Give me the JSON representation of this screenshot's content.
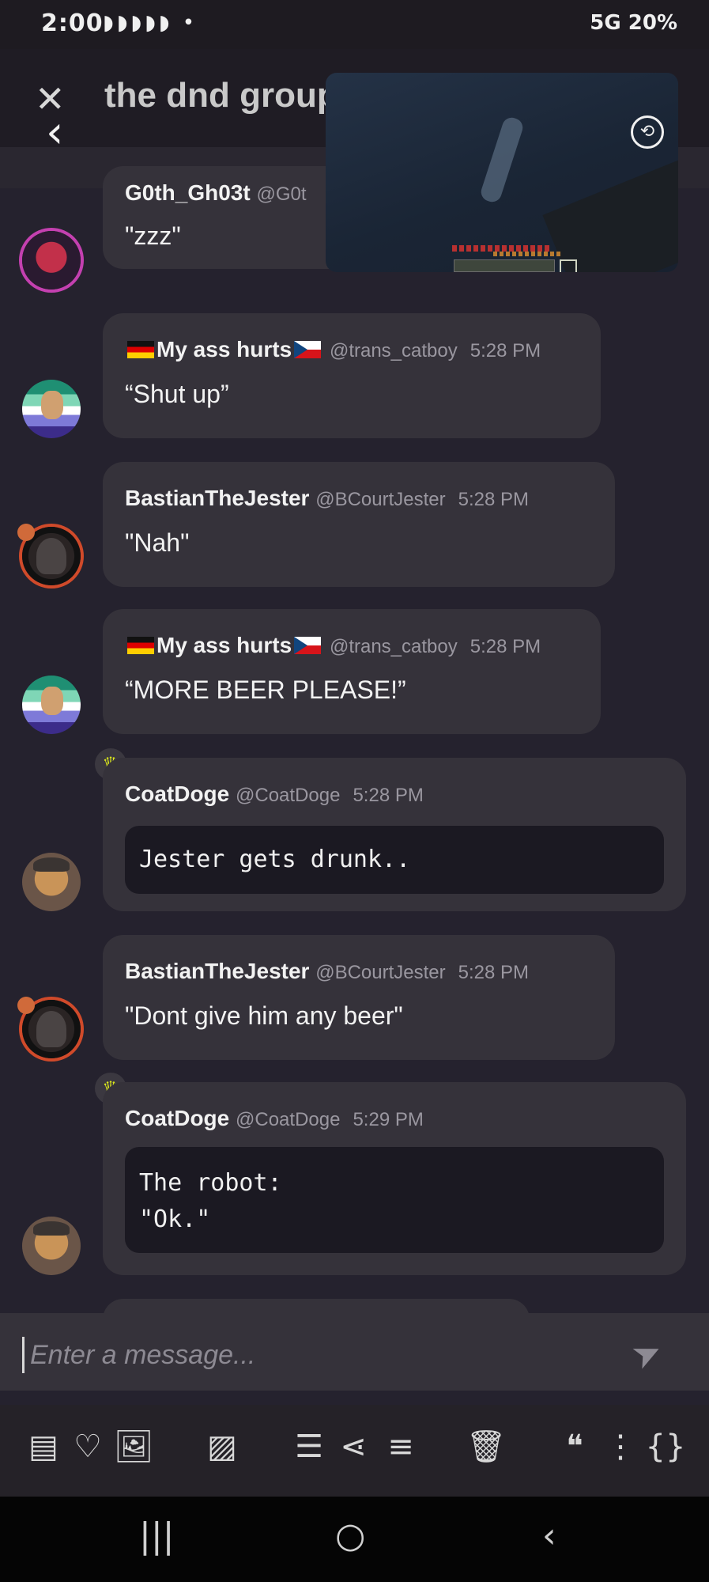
{
  "status_bar": {
    "time": "2:00",
    "notification_icons": "◗◗◗◗◗ •",
    "right_text": "5G 20%"
  },
  "header": {
    "title": "the dnd group",
    "close_glyph": "✕",
    "back_glyph": "‹"
  },
  "video_overlay": {
    "rotate_glyph": "⟲"
  },
  "messages": [
    {
      "author": "G0th_Gh03t",
      "handle": "@G0t",
      "time": "",
      "text": "\"zzz\""
    },
    {
      "author_pre": "",
      "author_main": "My ass hurts",
      "handle": "@trans_catboy",
      "time": "5:28 PM",
      "text": "“Shut up”"
    },
    {
      "author": "BastianTheJester",
      "glitch": "̴̢̛̰̗̃̀",
      "handle": "@BCourtJester",
      "time": "5:28 PM",
      "text": "\"Nah\""
    },
    {
      "author_main": "My ass hurts",
      "handle": "@trans_catboy",
      "time": "5:28 PM",
      "text": "“MORE BEER PLEASE!”"
    },
    {
      "author": "CoatDoge",
      "handle": "@CoatDoge",
      "time": "5:28 PM",
      "code": "Jester gets drunk.."
    },
    {
      "author": "BastianTheJester",
      "handle": "@BCourtJester",
      "time": "5:28 PM",
      "text": "\"Dont give him any beer\""
    },
    {
      "author": "CoatDoge",
      "handle": "@CoatDoge",
      "time": "5:29 PM",
      "code_line1": "The robot:",
      "code_line2": "\"Ok.\""
    }
  ],
  "composer": {
    "placeholder": "Enter a message...",
    "send_glyph": "➤"
  },
  "toolbar": {
    "icons": [
      "spoiler-icon",
      "heart-icon",
      "image-icon",
      "gif-icon",
      "bullet-list-icon",
      "share-icon",
      "numbered-list-icon",
      "trash-icon",
      "quote-icon",
      "more-icon",
      "code-icon"
    ],
    "glyphs": [
      "▤",
      "♡",
      "🖼",
      "▨",
      "☰",
      "⋖",
      "≡",
      "🗑",
      "❝",
      "⋮",
      "{}"
    ]
  },
  "nav_bar": {
    "recents": "|||",
    "home": "○",
    "back": "‹"
  },
  "colors": {
    "background": "#25222e",
    "bubble": "#35323a",
    "code_block": "#1b1922",
    "crown": "#d9e61c"
  }
}
